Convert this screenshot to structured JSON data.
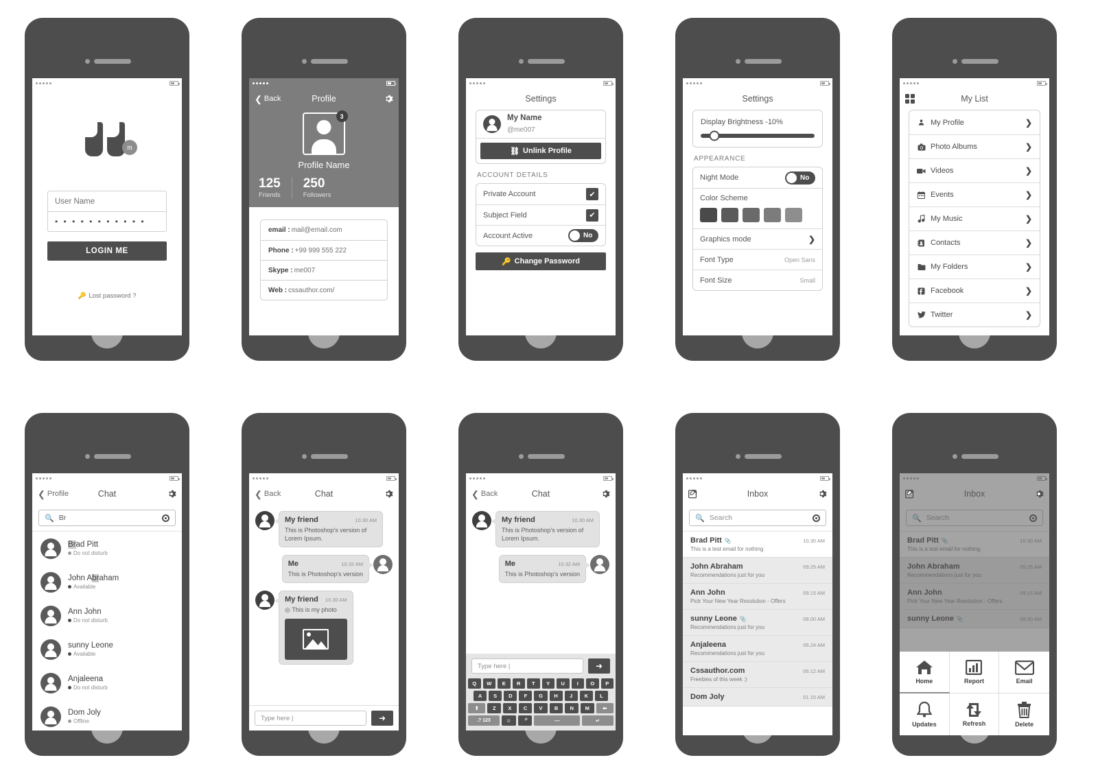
{
  "screens": {
    "login": {
      "logo_badge": "m",
      "username_value": "User Name",
      "password_value": "• • • • • • • • • • •",
      "login_button": "LOGIN ME",
      "lost_password": "Lost password ?"
    },
    "profile": {
      "nav": {
        "back": "Back",
        "title": "Profile"
      },
      "avatar_badge": "3",
      "name": "Profile Name",
      "stats": [
        {
          "value": "125",
          "label": "Friends"
        },
        {
          "value": "250",
          "label": "Followers"
        }
      ],
      "info": [
        {
          "key": "email :",
          "value": "mail@email.com"
        },
        {
          "key": "Phone :",
          "value": "+99 999 555 222"
        },
        {
          "key": "Skype :",
          "value": "me007"
        },
        {
          "key": "Web :",
          "value": "cssauthor.com/"
        }
      ]
    },
    "settings_account": {
      "title": "Settings",
      "user_name": "My Name",
      "user_handle": "@me007",
      "unlink_button": "Unlink Profile",
      "section_label": "ACCOUNT DETAILS",
      "rows": [
        {
          "label": "Private Account",
          "control": "checkbox",
          "checked": "✔"
        },
        {
          "label": "Subject Field",
          "control": "checkbox",
          "checked": "✔"
        },
        {
          "label": "Account Active",
          "control": "toggle",
          "toggle_value": "No"
        }
      ],
      "change_password_button": "Change Password"
    },
    "settings_appearance": {
      "title": "Settings",
      "brightness_label": "Display Brightness -10%",
      "brightness_percent": 10,
      "section_label": "APPEARANCE",
      "night_mode_label": "Night Mode",
      "night_mode_value": "No",
      "color_scheme_label": "Color Scheme",
      "swatches": [
        "#4a4a4a",
        "#5a5a5a",
        "#6a6a6a",
        "#7c7c7c",
        "#8e8e8e"
      ],
      "rows": [
        {
          "label": "Graphics mode",
          "value": "",
          "chevron": "❯"
        },
        {
          "label": "Font Type",
          "value": "Open Sans",
          "chevron": ""
        },
        {
          "label": "Font Size",
          "value": "Small",
          "chevron": ""
        }
      ]
    },
    "my_list": {
      "title": "My List",
      "items": [
        {
          "label": "My Profile",
          "icon": "person-icon",
          "glyph": "👤",
          "chevron": "❯"
        },
        {
          "label": "Photo Albums",
          "icon": "camera-icon",
          "glyph": "📷",
          "chevron": "❯"
        },
        {
          "label": "Videos",
          "icon": "video-icon",
          "glyph": "🎥",
          "chevron": "❯"
        },
        {
          "label": "Events",
          "icon": "calendar-icon",
          "glyph": "📅",
          "chevron": "❯"
        },
        {
          "label": "My Music",
          "icon": "music-icon",
          "glyph": "♫",
          "chevron": "❯"
        },
        {
          "label": "Contacts",
          "icon": "contacts-icon",
          "glyph": "▤",
          "chevron": "❯"
        },
        {
          "label": "My Folders",
          "icon": "folder-icon",
          "glyph": "📁",
          "chevron": "❯"
        },
        {
          "label": "Facebook",
          "icon": "facebook-icon",
          "glyph": "f",
          "chevron": "❯"
        },
        {
          "label": "Twitter",
          "icon": "twitter-icon",
          "glyph": "🐦",
          "chevron": "❯"
        }
      ]
    },
    "chat_contacts": {
      "nav": {
        "back": "Profile",
        "title": "Chat"
      },
      "search_value": "Br",
      "contacts": [
        {
          "name": "Brad Pitt",
          "highlight": "Br",
          "status": "Do not disturb",
          "status_color": "#9b9b9b"
        },
        {
          "name": "John Abraham",
          "highlight": "br",
          "status": "Available",
          "status_color": "#4a4a4a"
        },
        {
          "name": "Ann John",
          "highlight": "",
          "status": "Do not disturb",
          "status_color": "#4a4a4a"
        },
        {
          "name": "sunny Leone",
          "highlight": "",
          "status": "Available",
          "status_color": "#4a4a4a"
        },
        {
          "name": "Anjaleena",
          "highlight": "",
          "status": "Do not disturb",
          "status_color": "#4a4a4a"
        },
        {
          "name": "Dom Joly",
          "highlight": "",
          "status": "Offline",
          "status_color": "#9b9b9b"
        }
      ]
    },
    "chat_photo": {
      "nav": {
        "back": "Back",
        "title": "Chat"
      },
      "messages": [
        {
          "side": "them",
          "name": "My friend",
          "time": "10.30 AM",
          "text": "This is Photoshop's version of Lorem Ipsum.",
          "photo": false
        },
        {
          "side": "me",
          "name": "Me",
          "time": "10.32 AM",
          "text": "This is Photoshop's version",
          "photo": false
        },
        {
          "side": "them",
          "name": "My friend",
          "time": "10.30 AM",
          "text": "This is my photo",
          "photo": true
        }
      ],
      "composer_placeholder": "Type here |"
    },
    "chat_keyboard": {
      "nav": {
        "back": "Back",
        "title": "Chat"
      },
      "messages": [
        {
          "side": "them",
          "name": "My friend",
          "time": "10.30 AM",
          "text": "This is Photoshop's version of Lorem Ipsum."
        },
        {
          "side": "me",
          "name": "Me",
          "time": "10.32 AM",
          "text": "This is Photoshop's version"
        }
      ],
      "composer_placeholder": "Type here |",
      "keyboard": {
        "row1": [
          "Q",
          "W",
          "E",
          "R",
          "T",
          "Y",
          "U",
          "I",
          "O",
          "P"
        ],
        "row2": [
          "A",
          "S",
          "D",
          "F",
          "G",
          "H",
          "J",
          "K",
          "L"
        ],
        "row3": [
          "⬆",
          "Z",
          "X",
          "C",
          "V",
          "B",
          "N",
          "M",
          "⬅"
        ],
        "row4": [
          ".? 123",
          "☺",
          "🎤",
          "—",
          "↵"
        ]
      }
    },
    "inbox": {
      "title": "Inbox",
      "search_placeholder": "Search",
      "mails": [
        {
          "name": "Brad Pitt",
          "clip": true,
          "time": "10.30 AM",
          "subject": "This is a test email for nothing",
          "read": false
        },
        {
          "name": "John Abraham",
          "clip": false,
          "time": "09.25 AM",
          "subject": "Recommendations just for you",
          "read": true
        },
        {
          "name": "Ann John",
          "clip": false,
          "time": "09.15 AM",
          "subject": "Pick Your New Year Resolution - Offers",
          "read": true
        },
        {
          "name": "sunny Leone",
          "clip": true,
          "time": "08.00 AM",
          "subject": "Recommendations just for you",
          "read": true
        },
        {
          "name": "Anjaleena",
          "clip": false,
          "time": "06.24 AM",
          "subject": "Recommendations just for you",
          "read": true
        },
        {
          "name": "Cssauthor.com",
          "clip": false,
          "time": "06.12 AM",
          "subject": "Freebies of this week :)",
          "read": true
        },
        {
          "name": "Dom Joly",
          "clip": false,
          "time": "01.15 AM",
          "subject": "",
          "read": true
        }
      ]
    },
    "inbox_menu": {
      "title": "Inbox",
      "search_placeholder": "Search",
      "mails": [
        {
          "name": "Brad Pitt",
          "clip": true,
          "time": "10.30 AM",
          "subject": "This is a test email for nothing",
          "read": false
        },
        {
          "name": "John Abraham",
          "clip": false,
          "time": "09.25 AM",
          "subject": "Recommendations just for you",
          "read": true
        },
        {
          "name": "Ann John",
          "clip": false,
          "time": "09.15 AM",
          "subject": "Pick Your New Year Resolution - Offers",
          "read": true
        },
        {
          "name": "sunny Leone",
          "clip": true,
          "time": "08.00 AM",
          "subject": "",
          "read": true
        }
      ],
      "actions": [
        {
          "label": "Home",
          "icon": "home-icon"
        },
        {
          "label": "Report",
          "icon": "chart-icon"
        },
        {
          "label": "Email",
          "icon": "envelope-icon"
        },
        {
          "label": "Updates",
          "icon": "bell-icon"
        },
        {
          "label": "Refresh",
          "icon": "refresh-icon"
        },
        {
          "label": "Delete",
          "icon": "trash-icon"
        }
      ]
    }
  },
  "colors": {
    "frame": "#4d4d4d",
    "accent_dark": "#4d4d4d",
    "profile_header": "#7d7d7d",
    "bubble": "#e2e2e2",
    "read_row": "#eaeaea"
  }
}
